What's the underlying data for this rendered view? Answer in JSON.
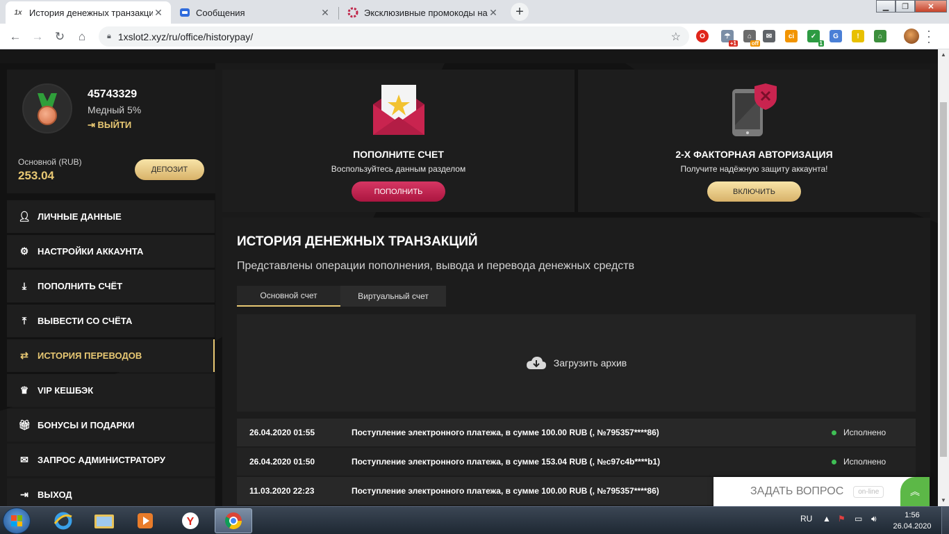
{
  "browser": {
    "tabs": [
      {
        "title": "История денежных транзакций",
        "favicon": "1x",
        "active": true
      },
      {
        "title": "Сообщения",
        "favicon": "chat",
        "active": false
      },
      {
        "title": "Эксклюзивные промокоды на ф",
        "favicon": "promo",
        "active": false
      }
    ],
    "url": "1xslot2.xyz/ru/office/historypay/",
    "extensions": {
      "badge_plus1": "+1",
      "badge_off": "off",
      "badge_1": "1",
      "ext_ci": "ci"
    }
  },
  "profile": {
    "user_id": "45743329",
    "level": "Медный 5%",
    "logout_label": "ВЫЙТИ",
    "account_label": "Основной (RUB)",
    "balance": "253.04",
    "deposit_label": "ДЕПОЗИТ"
  },
  "menu": [
    {
      "label": "ЛИЧНЫЕ ДАННЫЕ",
      "icon": "user-add-icon"
    },
    {
      "label": "НАСТРОЙКИ АККАУНТА",
      "icon": "gears-icon"
    },
    {
      "label": "ПОПОЛНИТЬ СЧЁТ",
      "icon": "download-icon"
    },
    {
      "label": "ВЫВЕСТИ СО СЧЁТА",
      "icon": "upload-icon"
    },
    {
      "label": "ИСТОРИЯ ПЕРЕВОДОВ",
      "icon": "transfer-icon",
      "active": true
    },
    {
      "label": "VIP КЕШБЭК",
      "icon": "crown-icon"
    },
    {
      "label": "БОНУСЫ И ПОДАРКИ",
      "icon": "gift-icon"
    },
    {
      "label": "ЗАПРОС АДМИНИСТРАТОРУ",
      "icon": "envelope-icon"
    },
    {
      "label": "ВЫХОД",
      "icon": "exit-icon"
    }
  ],
  "promo_deposit": {
    "title": "ПОПОЛНИТЕ СЧЕТ",
    "subtitle": "Воспользуйтесь данным разделом",
    "button": "ПОПОЛНИТЬ"
  },
  "promo_2fa": {
    "title": "2-Х ФАКТОРНАЯ АВТОРИЗАЦИЯ",
    "subtitle": "Получите надёжную защиту аккаунта!",
    "button": "ВКЛЮЧИТЬ"
  },
  "history": {
    "title": "ИСТОРИЯ ДЕНЕЖНЫХ ТРАНЗАКЦИЙ",
    "subtitle": "Представлены операции пополнения, вывода и перевода денежных средств",
    "tabs": [
      "Основной счет",
      "Виртуальный счет"
    ],
    "archive_label": "Загрузить архив",
    "rows": [
      {
        "date": "26.04.2020 01:55",
        "description": "Поступление электронного платежа, в сумме 100.00 RUB (, №795357****86)",
        "status": "Исполнено"
      },
      {
        "date": "26.04.2020 01:50",
        "description": "Поступление электронного платежа, в сумме 153.04 RUB (, №c97c4b****b1)",
        "status": "Исполнено"
      },
      {
        "date": "11.03.2020 22:23",
        "description": "Поступление электронного платежа, в сумме 100.00 RUB (, №795357****86)",
        "status": ""
      }
    ]
  },
  "chat": {
    "label": "ЗАДАТЬ ВОПРОС",
    "status": "on-line"
  },
  "taskbar": {
    "lang": "RU",
    "time": "1:56",
    "date": "26.04.2020"
  },
  "colors": {
    "gold": "#e8c873",
    "red": "#c4204e",
    "green": "#3fbf55"
  }
}
